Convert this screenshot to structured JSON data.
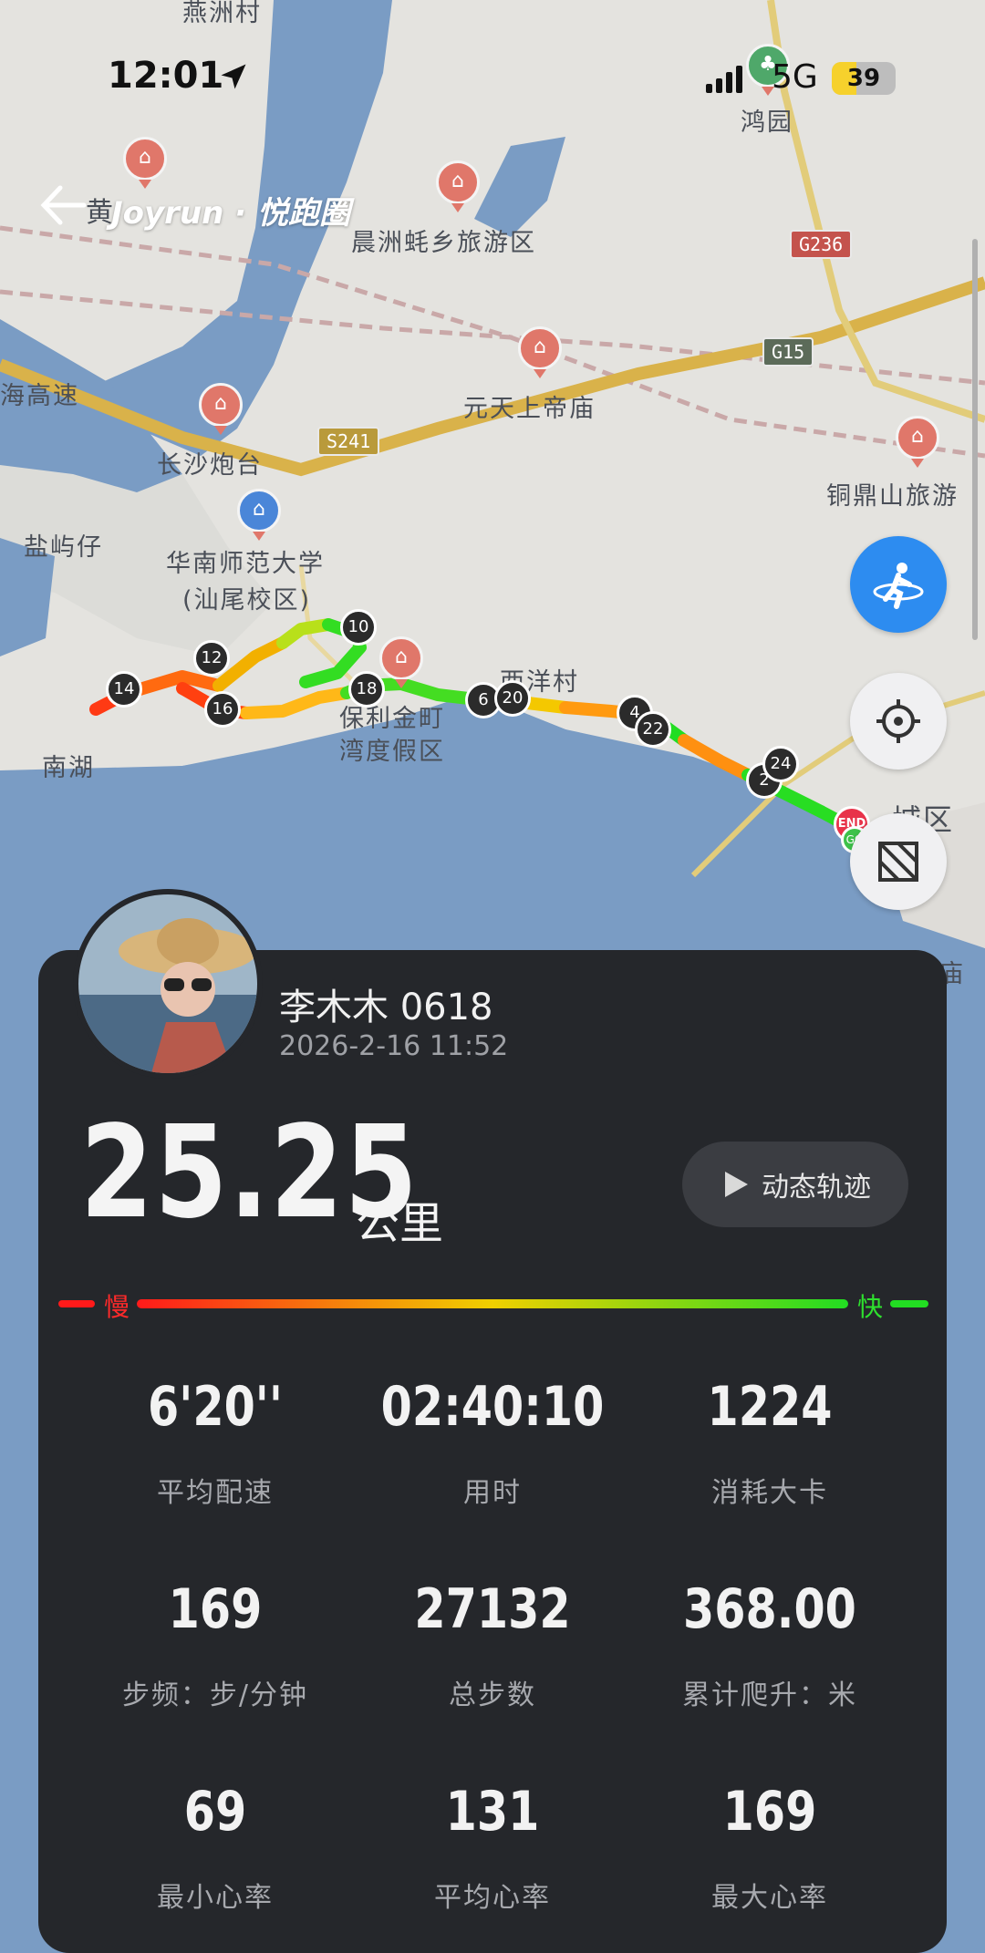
{
  "status_bar": {
    "time": "12:01",
    "network": "5G",
    "battery": "39"
  },
  "header": {
    "brand": "Joyrun · 悦跑圈",
    "back_label": "黄"
  },
  "map": {
    "labels": [
      "燕洲村",
      "鸿园",
      "晨洲蚝乡旅游区",
      "元天上帝庙",
      "长沙炮台",
      "海高速",
      "盐屿仔",
      "华南师范大学",
      "(汕尾校区)",
      "南湖",
      "西洋村",
      "保利金町",
      "湾度假区",
      "铜鼎山旅游",
      "城区",
      "祖庙"
    ],
    "roads": [
      "G236",
      "G15",
      "S241"
    ],
    "km_markers": [
      "10",
      "12",
      "14",
      "16",
      "18",
      "6",
      "20",
      "4",
      "22",
      "2",
      "24"
    ],
    "end_label": "END",
    "go_label": "GO"
  },
  "profile": {
    "name": "李木木 0618",
    "datetime": "2026-2-16 11:52"
  },
  "distance": {
    "value": "25.25",
    "unit": "公里"
  },
  "replay_button": "动态轨迹",
  "pace_legend": {
    "slow": "慢",
    "fast": "快"
  },
  "stats": [
    {
      "value": "6'20''",
      "label": "平均配速"
    },
    {
      "value": "02:40:10",
      "label": "用时"
    },
    {
      "value": "1224",
      "label": "消耗大卡"
    },
    {
      "value": "169",
      "label": "步频：步/分钟"
    },
    {
      "value": "27132",
      "label": "总步数"
    },
    {
      "value": "368.00",
      "label": "累计爬升：米"
    },
    {
      "value": "69",
      "label": "最小心率"
    },
    {
      "value": "131",
      "label": "平均心率"
    },
    {
      "value": "169",
      "label": "最大心率"
    }
  ],
  "colors": {
    "route_slow": "#ff1a1a",
    "route_mid": "#f0d000",
    "route_fast": "#22dd22",
    "card_bg": "#25272b",
    "sea": "#7a9cc4"
  }
}
